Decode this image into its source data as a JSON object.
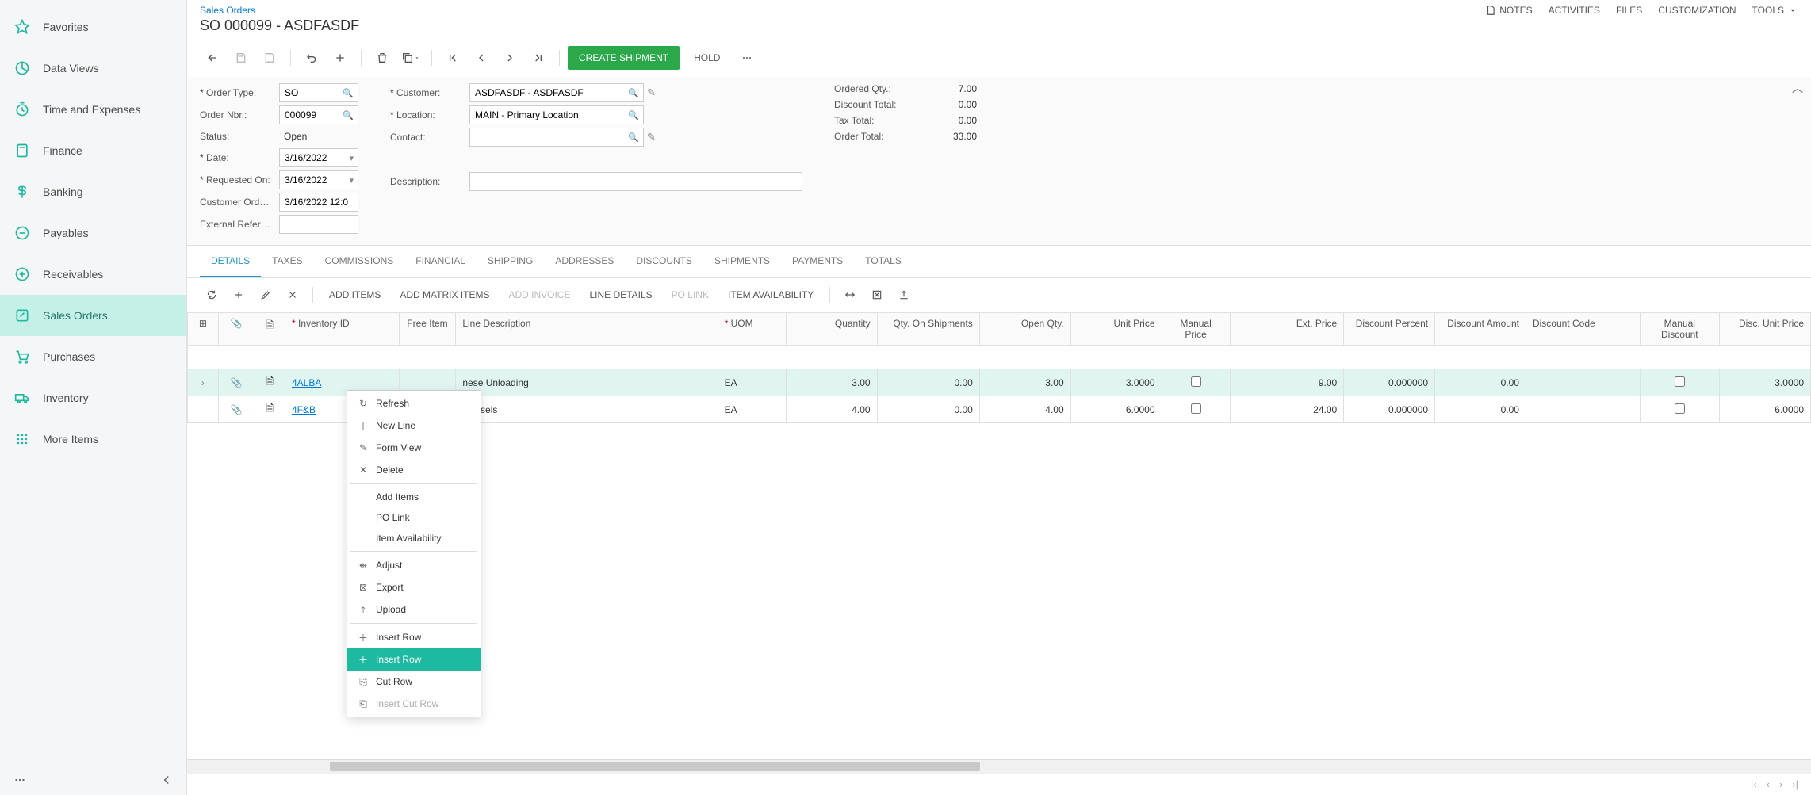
{
  "sidebar": {
    "items": [
      {
        "label": "Favorites"
      },
      {
        "label": "Data Views"
      },
      {
        "label": "Time and Expenses"
      },
      {
        "label": "Finance"
      },
      {
        "label": "Banking"
      },
      {
        "label": "Payables"
      },
      {
        "label": "Receivables"
      },
      {
        "label": "Sales Orders"
      },
      {
        "label": "Purchases"
      },
      {
        "label": "Inventory"
      },
      {
        "label": "More Items"
      }
    ]
  },
  "header": {
    "breadcrumb": "Sales Orders",
    "title": "SO 000099 - ASDFASDF",
    "links": {
      "notes": "NOTES",
      "activities": "ACTIVITIES",
      "files": "FILES",
      "customization": "CUSTOMIZATION",
      "tools": "TOOLS"
    }
  },
  "toolbar": {
    "create_shipment": "CREATE SHIPMENT",
    "hold": "HOLD"
  },
  "form": {
    "labels": {
      "order_type": "Order Type:",
      "order_nbr": "Order Nbr.:",
      "status": "Status:",
      "date": "Date:",
      "requested_on": "Requested On:",
      "customer_ord": "Customer Ord…",
      "external_ref": "External Refer…",
      "customer": "Customer:",
      "location": "Location:",
      "contact": "Contact:",
      "description": "Description:",
      "ordered_qty": "Ordered Qty.:",
      "discount_total": "Discount Total:",
      "tax_total": "Tax Total:",
      "order_total": "Order Total:"
    },
    "values": {
      "order_type": "SO",
      "order_nbr": "000099",
      "status": "Open",
      "date": "3/16/2022",
      "requested_on": "3/16/2022",
      "customer_ord": "3/16/2022 12:0",
      "external_ref": "",
      "customer": "ASDFASDF - ASDFASDF",
      "location": "MAIN - Primary Location",
      "contact": "",
      "description": "",
      "ordered_qty": "7.00",
      "discount_total": "0.00",
      "tax_total": "0.00",
      "order_total": "33.00"
    }
  },
  "tabs": [
    "DETAILS",
    "TAXES",
    "COMMISSIONS",
    "FINANCIAL",
    "SHIPPING",
    "ADDRESSES",
    "DISCOUNTS",
    "SHIPMENTS",
    "PAYMENTS",
    "TOTALS"
  ],
  "grid_toolbar": {
    "add_items": "ADD ITEMS",
    "add_matrix": "ADD MATRIX ITEMS",
    "add_invoice": "ADD INVOICE",
    "line_details": "LINE DETAILS",
    "po_link": "PO LINK",
    "item_avail": "ITEM AVAILABILITY"
  },
  "grid": {
    "columns": {
      "inv": "Inventory ID",
      "free": "Free Item",
      "desc": "Line Description",
      "uom": "UOM",
      "qty": "Quantity",
      "qty_ship": "Qty. On Shipments",
      "open_qty": "Open Qty.",
      "unit_price": "Unit Price",
      "manual_price": "Manual Price",
      "ext_price": "Ext. Price",
      "disc_pct": "Discount Percent",
      "disc_amt": "Discount Amount",
      "disc_code": "Discount Code",
      "manual_disc": "Manual Discount",
      "disc_unit_price": "Disc. Unit Price"
    },
    "rows": [
      {
        "inv": "4ALBA",
        "desc": "nese Unloading",
        "uom": "EA",
        "qty": "3.00",
        "qty_ship": "0.00",
        "open_qty": "3.00",
        "unit_price": "3.0000",
        "ext_price": "9.00",
        "disc_pct": "0.000000",
        "disc_amt": "0.00",
        "disc_unit": "3.0000"
      },
      {
        "inv": "4F&B",
        "desc": "Mussels",
        "uom": "EA",
        "qty": "4.00",
        "qty_ship": "0.00",
        "open_qty": "4.00",
        "unit_price": "6.0000",
        "ext_price": "24.00",
        "disc_pct": "0.000000",
        "disc_amt": "0.00",
        "disc_unit": "6.0000"
      }
    ]
  },
  "context_menu": {
    "refresh": "Refresh",
    "new_line": "New Line",
    "form_view": "Form View",
    "delete": "Delete",
    "add_items": "Add Items",
    "po_link": "PO Link",
    "item_avail": "Item Availability",
    "adjust": "Adjust",
    "export": "Export",
    "upload": "Upload",
    "insert_row1": "Insert Row",
    "insert_row2": "Insert Row",
    "cut_row": "Cut Row",
    "insert_cut": "Insert Cut Row"
  }
}
